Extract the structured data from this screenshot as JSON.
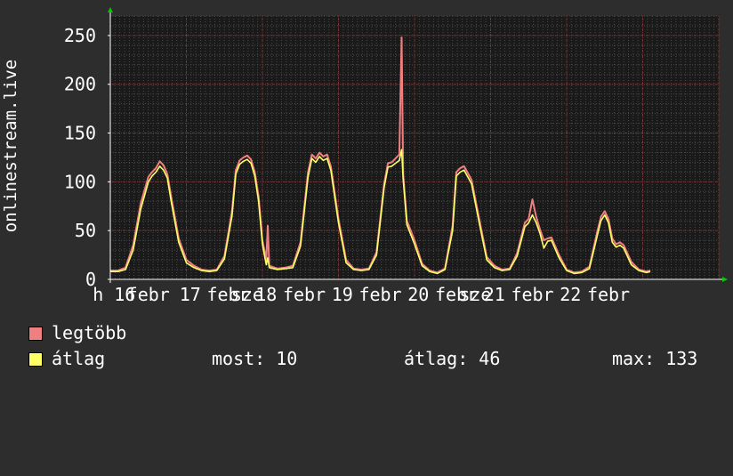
{
  "colors": {
    "background": "#2d2d2d",
    "plot_background": "#1a1a1a",
    "grid_major": "#6b3a3a",
    "grid_minor": "#4a4a4a",
    "text": "#ffffff",
    "series_max": "#f08080",
    "series_avg": "#ffff66",
    "axis_arrow": "#00cc00"
  },
  "chart_data": {
    "type": "line",
    "ylabel": "onlinestream.live",
    "ylim": [
      0,
      270
    ],
    "yticks": [
      0,
      50,
      100,
      150,
      200,
      250
    ],
    "xlim": [
      0,
      8
    ],
    "grid": true,
    "x_tick_labels": [
      "h 16",
      "febr",
      "17",
      "febr",
      "sze",
      "18",
      "febr",
      "19",
      "febr",
      "20",
      "febr",
      "sze",
      "21",
      "febr",
      "22",
      "febr"
    ],
    "x_tick_positions": [
      0.05,
      0.5,
      1.05,
      1.55,
      1.8,
      2.05,
      2.55,
      3.05,
      3.55,
      4.05,
      4.55,
      4.8,
      5.05,
      5.55,
      6.05,
      6.55
    ],
    "series": [
      {
        "name": "legtöbb",
        "color": "#f08080",
        "points": [
          [
            0.0,
            9
          ],
          [
            0.1,
            9
          ],
          [
            0.2,
            12
          ],
          [
            0.3,
            35
          ],
          [
            0.4,
            78
          ],
          [
            0.5,
            105
          ],
          [
            0.55,
            110
          ],
          [
            0.6,
            114
          ],
          [
            0.65,
            121
          ],
          [
            0.7,
            117
          ],
          [
            0.75,
            108
          ],
          [
            0.8,
            85
          ],
          [
            0.9,
            42
          ],
          [
            1.0,
            20
          ],
          [
            1.1,
            14
          ],
          [
            1.2,
            10
          ],
          [
            1.3,
            9
          ],
          [
            1.4,
            10
          ],
          [
            1.5,
            24
          ],
          [
            1.6,
            70
          ],
          [
            1.65,
            112
          ],
          [
            1.7,
            122
          ],
          [
            1.75,
            125
          ],
          [
            1.8,
            127
          ],
          [
            1.85,
            123
          ],
          [
            1.9,
            110
          ],
          [
            1.95,
            85
          ],
          [
            2.0,
            40
          ],
          [
            2.05,
            20
          ],
          [
            2.07,
            55
          ],
          [
            2.09,
            14
          ],
          [
            2.2,
            11
          ],
          [
            2.3,
            12
          ],
          [
            2.4,
            14
          ],
          [
            2.5,
            38
          ],
          [
            2.6,
            110
          ],
          [
            2.65,
            128
          ],
          [
            2.7,
            124
          ],
          [
            2.75,
            130
          ],
          [
            2.8,
            126
          ],
          [
            2.85,
            128
          ],
          [
            2.9,
            116
          ],
          [
            3.0,
            62
          ],
          [
            3.1,
            20
          ],
          [
            3.2,
            11
          ],
          [
            3.3,
            10
          ],
          [
            3.4,
            11
          ],
          [
            3.5,
            28
          ],
          [
            3.6,
            98
          ],
          [
            3.65,
            119
          ],
          [
            3.7,
            120
          ],
          [
            3.75,
            124
          ],
          [
            3.8,
            128
          ],
          [
            3.83,
            248
          ],
          [
            3.85,
            108
          ],
          [
            3.9,
            60
          ],
          [
            4.0,
            40
          ],
          [
            4.1,
            16
          ],
          [
            4.2,
            9
          ],
          [
            4.3,
            7
          ],
          [
            4.4,
            11
          ],
          [
            4.5,
            55
          ],
          [
            4.55,
            110
          ],
          [
            4.6,
            114
          ],
          [
            4.65,
            116
          ],
          [
            4.7,
            109
          ],
          [
            4.75,
            102
          ],
          [
            4.85,
            62
          ],
          [
            4.95,
            23
          ],
          [
            5.05,
            14
          ],
          [
            5.15,
            10
          ],
          [
            5.25,
            11
          ],
          [
            5.35,
            27
          ],
          [
            5.45,
            58
          ],
          [
            5.5,
            62
          ],
          [
            5.55,
            82
          ],
          [
            5.6,
            64
          ],
          [
            5.65,
            51
          ],
          [
            5.7,
            40
          ],
          [
            5.75,
            42
          ],
          [
            5.8,
            43
          ],
          [
            5.9,
            25
          ],
          [
            6.0,
            10
          ],
          [
            6.1,
            7
          ],
          [
            6.2,
            8
          ],
          [
            6.3,
            13
          ],
          [
            6.4,
            48
          ],
          [
            6.45,
            64
          ],
          [
            6.5,
            70
          ],
          [
            6.55,
            62
          ],
          [
            6.6,
            42
          ],
          [
            6.65,
            36
          ],
          [
            6.7,
            38
          ],
          [
            6.75,
            35
          ],
          [
            6.85,
            18
          ],
          [
            6.95,
            10
          ],
          [
            7.05,
            8
          ],
          [
            7.1,
            9
          ]
        ]
      },
      {
        "name": "átlag",
        "color": "#ffff66",
        "points": [
          [
            0.0,
            8
          ],
          [
            0.1,
            8
          ],
          [
            0.2,
            10
          ],
          [
            0.3,
            30
          ],
          [
            0.4,
            72
          ],
          [
            0.5,
            100
          ],
          [
            0.55,
            106
          ],
          [
            0.6,
            110
          ],
          [
            0.65,
            116
          ],
          [
            0.7,
            112
          ],
          [
            0.75,
            104
          ],
          [
            0.8,
            80
          ],
          [
            0.9,
            38
          ],
          [
            1.0,
            17
          ],
          [
            1.1,
            12
          ],
          [
            1.2,
            9
          ],
          [
            1.3,
            8
          ],
          [
            1.4,
            9
          ],
          [
            1.5,
            21
          ],
          [
            1.6,
            65
          ],
          [
            1.65,
            108
          ],
          [
            1.7,
            118
          ],
          [
            1.75,
            121
          ],
          [
            1.8,
            123
          ],
          [
            1.85,
            119
          ],
          [
            1.9,
            106
          ],
          [
            1.95,
            80
          ],
          [
            2.0,
            36
          ],
          [
            2.05,
            15
          ],
          [
            2.07,
            22
          ],
          [
            2.09,
            12
          ],
          [
            2.2,
            10
          ],
          [
            2.3,
            11
          ],
          [
            2.4,
            12
          ],
          [
            2.5,
            34
          ],
          [
            2.6,
            105
          ],
          [
            2.65,
            124
          ],
          [
            2.7,
            120
          ],
          [
            2.75,
            126
          ],
          [
            2.8,
            122
          ],
          [
            2.85,
            124
          ],
          [
            2.9,
            112
          ],
          [
            3.0,
            58
          ],
          [
            3.1,
            17
          ],
          [
            3.2,
            10
          ],
          [
            3.3,
            9
          ],
          [
            3.4,
            10
          ],
          [
            3.5,
            25
          ],
          [
            3.6,
            94
          ],
          [
            3.65,
            115
          ],
          [
            3.7,
            116
          ],
          [
            3.75,
            119
          ],
          [
            3.8,
            122
          ],
          [
            3.83,
            133
          ],
          [
            3.85,
            103
          ],
          [
            3.9,
            56
          ],
          [
            4.0,
            36
          ],
          [
            4.1,
            14
          ],
          [
            4.2,
            8
          ],
          [
            4.3,
            6
          ],
          [
            4.4,
            10
          ],
          [
            4.5,
            50
          ],
          [
            4.55,
            106
          ],
          [
            4.6,
            110
          ],
          [
            4.65,
            112
          ],
          [
            4.7,
            105
          ],
          [
            4.75,
            98
          ],
          [
            4.85,
            58
          ],
          [
            4.95,
            20
          ],
          [
            5.05,
            12
          ],
          [
            5.15,
            9
          ],
          [
            5.25,
            10
          ],
          [
            5.35,
            24
          ],
          [
            5.45,
            54
          ],
          [
            5.5,
            58
          ],
          [
            5.55,
            66
          ],
          [
            5.6,
            58
          ],
          [
            5.65,
            47
          ],
          [
            5.7,
            32
          ],
          [
            5.75,
            39
          ],
          [
            5.8,
            40
          ],
          [
            5.9,
            22
          ],
          [
            6.0,
            9
          ],
          [
            6.1,
            6
          ],
          [
            6.2,
            7
          ],
          [
            6.3,
            11
          ],
          [
            6.4,
            44
          ],
          [
            6.45,
            60
          ],
          [
            6.5,
            66
          ],
          [
            6.55,
            58
          ],
          [
            6.6,
            38
          ],
          [
            6.65,
            33
          ],
          [
            6.7,
            35
          ],
          [
            6.75,
            32
          ],
          [
            6.85,
            15
          ],
          [
            6.95,
            9
          ],
          [
            7.05,
            7
          ],
          [
            7.1,
            8
          ]
        ]
      }
    ]
  },
  "legend": {
    "max_label": "legtöbb",
    "avg_label": "átlag"
  },
  "stats": {
    "now": "most: 10",
    "avg": "átlag: 46",
    "max": "max: 133"
  }
}
